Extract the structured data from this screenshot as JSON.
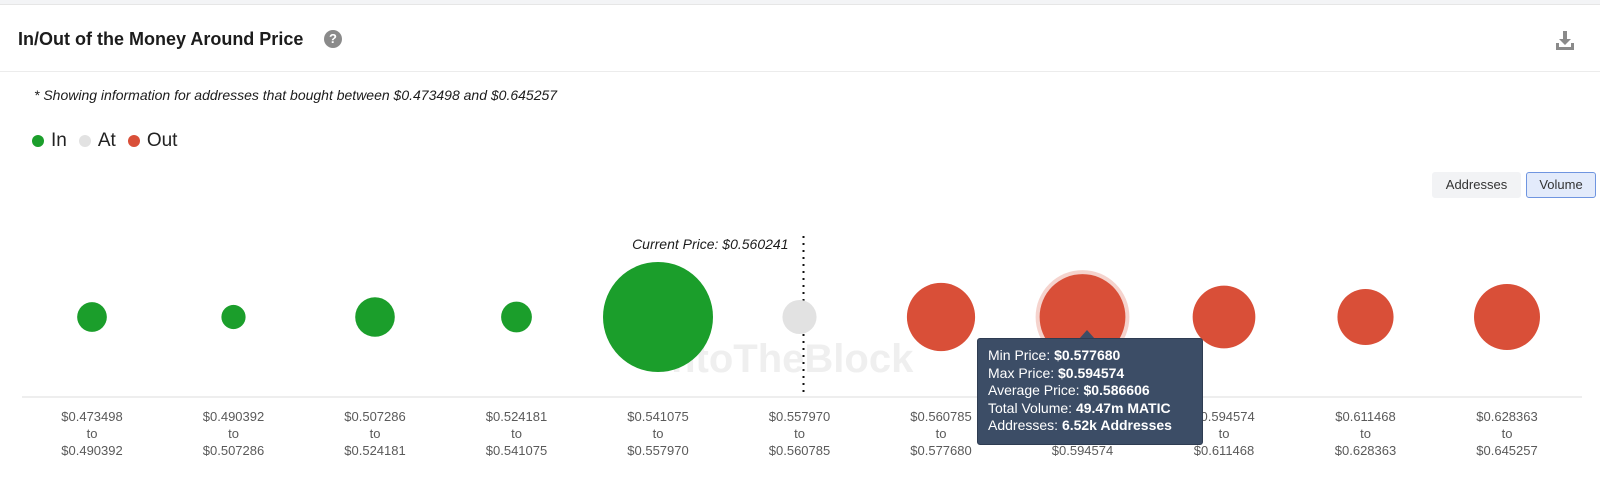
{
  "header": {
    "title": "In/Out of the Money Around Price",
    "help_icon": "question-circle-icon",
    "download_icon": "download-icon"
  },
  "note": "* Showing information for addresses that bought between $0.473498 and $0.645257",
  "legend": [
    {
      "label": "In",
      "color": "#1b9e2b"
    },
    {
      "label": "At",
      "color": "#e2e2e2"
    },
    {
      "label": "Out",
      "color": "#d94f38"
    }
  ],
  "toggles": {
    "addresses": "Addresses",
    "volume": "Volume",
    "active": "Volume"
  },
  "watermark": "IntoTheBlock",
  "tooltip": {
    "min_label": "Min Price:",
    "min_value": "$0.577680",
    "max_label": "Max Price:",
    "max_value": "$0.594574",
    "avg_label": "Average Price:",
    "avg_value": "$0.586606",
    "vol_label": "Total Volume:",
    "vol_value": "49.47m MATIC",
    "addr_label": "Addresses:",
    "addr_value": "6.52k Addresses"
  },
  "chart_data": {
    "type": "scatter",
    "subtype": "bubble",
    "size_metric": "Volume",
    "current_price": 0.560241,
    "current_price_label": "Current Price: $0.560241",
    "highlighted_index": 7,
    "buckets": [
      {
        "from": "$0.473498",
        "to": "$0.490392",
        "status": "In",
        "relative_size": 0.27
      },
      {
        "from": "$0.490392",
        "to": "$0.507286",
        "status": "In",
        "relative_size": 0.22
      },
      {
        "from": "$0.507286",
        "to": "$0.524181",
        "status": "In",
        "relative_size": 0.36
      },
      {
        "from": "$0.524181",
        "to": "$0.541075",
        "status": "In",
        "relative_size": 0.28
      },
      {
        "from": "$0.541075",
        "to": "$0.557970",
        "status": "In",
        "relative_size": 1.0
      },
      {
        "from": "$0.557970",
        "to": "$0.560785",
        "status": "At",
        "relative_size": 0.31
      },
      {
        "from": "$0.560785",
        "to": "$0.577680",
        "status": "Out",
        "relative_size": 0.62
      },
      {
        "from": "$0.577680",
        "to": "$0.594574",
        "status": "Out",
        "relative_size": 0.78,
        "total_volume": "49.47m MATIC",
        "addresses": "6.52k Addresses",
        "average_price": "$0.586606"
      },
      {
        "from": "$0.594574",
        "to": "$0.611468",
        "status": "Out",
        "relative_size": 0.57
      },
      {
        "from": "$0.611468",
        "to": "$0.628363",
        "status": "Out",
        "relative_size": 0.51
      },
      {
        "from": "$0.628363",
        "to": "$0.645257",
        "status": "Out",
        "relative_size": 0.6
      }
    ],
    "tick_separator": "to"
  }
}
